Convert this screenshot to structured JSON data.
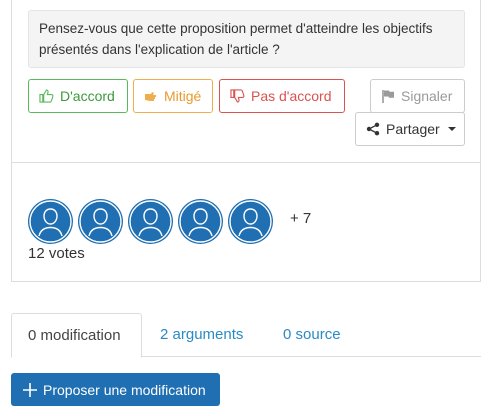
{
  "question": "Pensez-vous que cette proposition permet d'atteindre les objectifs présentés dans l'explication de l'article ?",
  "vote_buttons": {
    "agree": "D'accord",
    "mixed": "Mitigé",
    "disagree": "Pas d'accord"
  },
  "actions": {
    "report": "Signaler",
    "share": "Partager"
  },
  "voters": {
    "avatar_count": 5,
    "more": "+ 7",
    "votes_text": "12 votes"
  },
  "tabs": [
    {
      "label": "0 modification",
      "active": true
    },
    {
      "label": "2 arguments",
      "active": false
    },
    {
      "label": "0 source",
      "active": false
    }
  ],
  "propose_button": "Proposer une modification",
  "colors": {
    "agree": "#5cb85c",
    "mixed": "#f0ad4e",
    "disagree": "#d9534f",
    "primary": "#1f6fb2",
    "link": "#2a8ac4"
  },
  "icons": {
    "agree": "thumbs-up-icon",
    "mixed": "hand-icon",
    "disagree": "thumbs-down-icon",
    "report": "flag-icon",
    "share": "share-icon",
    "avatar": "user-silhouette-icon",
    "propose": "plus-icon"
  }
}
